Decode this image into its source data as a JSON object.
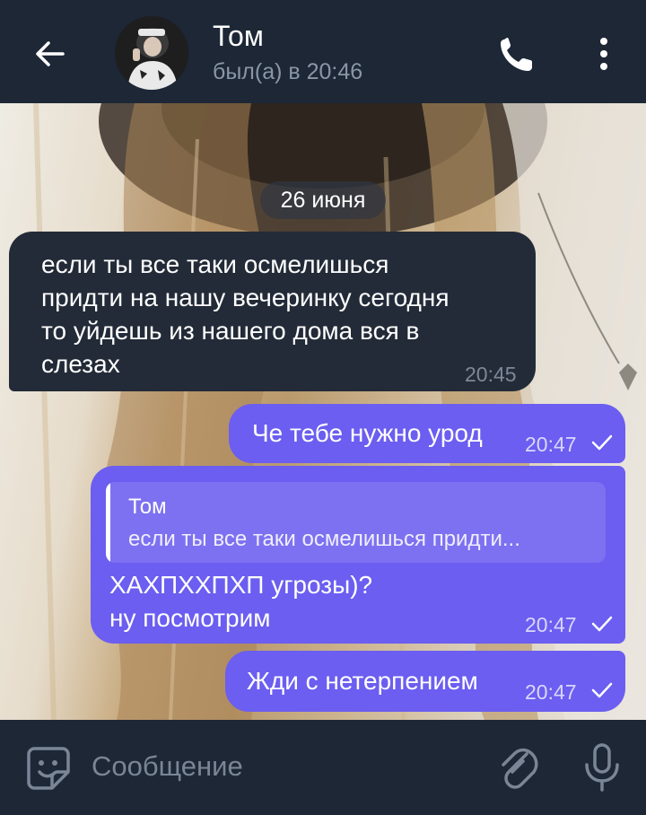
{
  "header": {
    "contact_name": "Том",
    "status": "был(а) в 20:46",
    "icons": [
      "back-arrow-icon",
      "phone-icon",
      "more-vertical-icon"
    ]
  },
  "chat": {
    "date_separator": "26 июня",
    "messages": [
      {
        "direction": "incoming",
        "lines": [
          "если ты все таки осмелишься",
          "придти на нашу вечеринку сегодня",
          "то уйдешь из нашего дома вся в",
          "слезах"
        ],
        "time": "20:45"
      },
      {
        "direction": "outgoing",
        "lines": [
          "Че тебе нужно урод"
        ],
        "time": "20:47",
        "status": "sent"
      },
      {
        "direction": "outgoing",
        "reply_to": {
          "name": "Том",
          "text": "если ты все таки осмелишься придти..."
        },
        "lines": [
          "ХАХПХХПХП угрозы)?",
          "ну посмотрим"
        ],
        "time": "20:47",
        "status": "sent"
      },
      {
        "direction": "outgoing",
        "lines": [
          "Жди с нетерпением"
        ],
        "time": "20:47",
        "status": "sent"
      }
    ]
  },
  "input": {
    "placeholder": "Сообщение",
    "icons": [
      "sticker-icon",
      "paperclip-icon",
      "microphone-icon"
    ]
  },
  "colors": {
    "header_bg": "#1d2736",
    "incoming_bubble": "#232b38",
    "outgoing_bubble": "#6b5ef0",
    "muted_text": "#8a96a6"
  }
}
